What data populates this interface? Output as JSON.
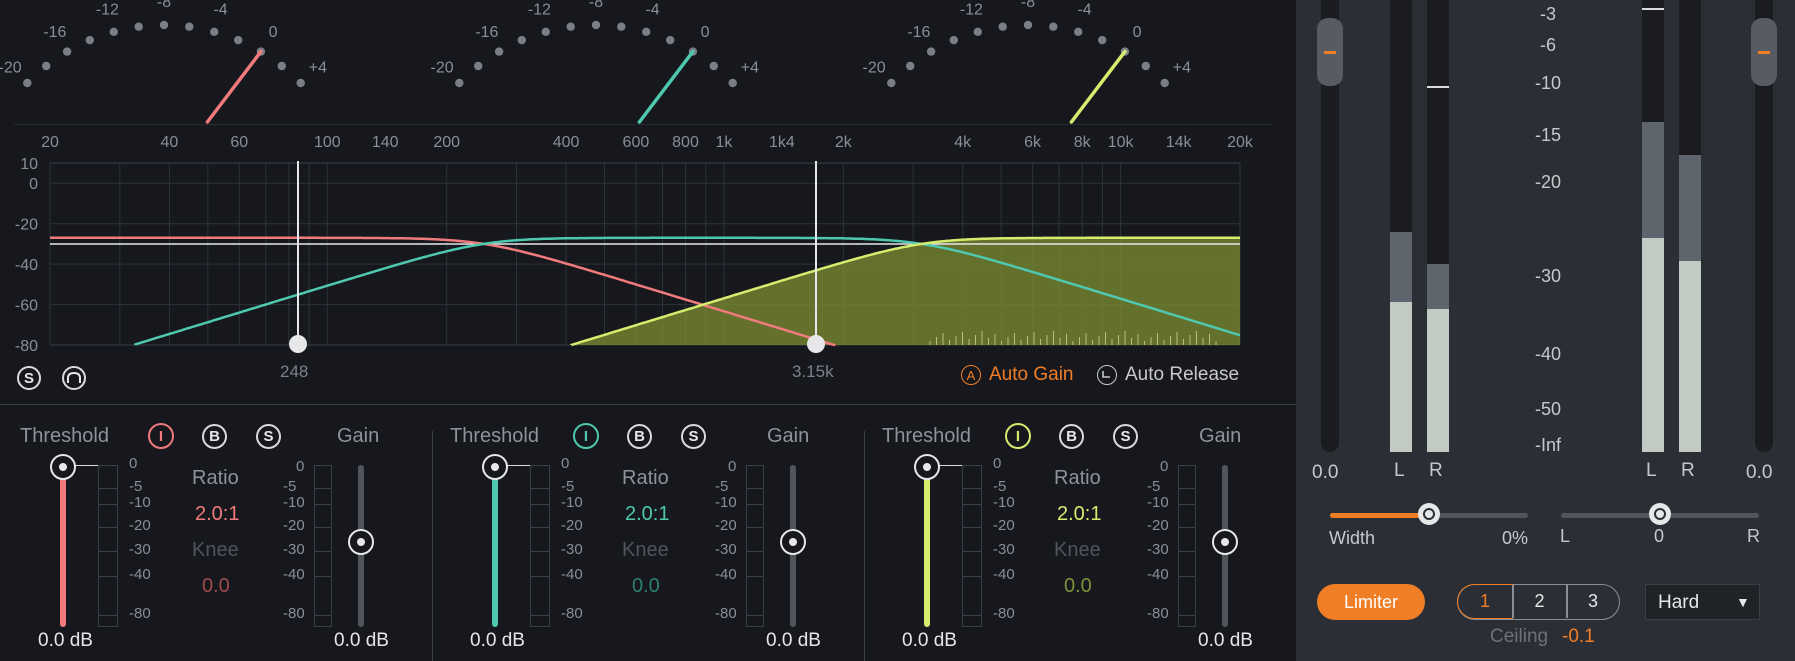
{
  "colors": {
    "band1": "#f07a7c",
    "band2": "#4ec9b0",
    "band3": "#d6ec6e",
    "accent": "#f07e26",
    "bg": "#16181d",
    "panel": "#2b2f35"
  },
  "meters": {
    "scale": [
      "-20",
      "-16",
      "-12",
      "-8",
      "-4",
      "0",
      "+4"
    ]
  },
  "freq_axis": [
    "20",
    "40",
    "60",
    "100",
    "140",
    "200",
    "400",
    "600",
    "800",
    "1k",
    "1k4",
    "2k",
    "4k",
    "6k",
    "8k",
    "10k",
    "14k",
    "20k"
  ],
  "db_axis": [
    "10",
    "0",
    "-20",
    "-40",
    "-60",
    "-80"
  ],
  "crossovers": [
    "248",
    "3.15k"
  ],
  "toolbar": {
    "solo_icon": "S",
    "shape_icon": "filter-shape-icon",
    "auto_gain": "Auto Gain",
    "auto_gain_icon": "A",
    "auto_release": "Auto Release"
  },
  "bands": [
    {
      "threshold_label": "Threshold",
      "bypass_icon": "I",
      "b_label": "B",
      "s_label": "S",
      "gain_label": "Gain",
      "ratio_label": "Ratio",
      "ratio": "2.0:1",
      "knee_label": "Knee",
      "knee": "0.0",
      "threshold_value": "0.0",
      "threshold_unit": "dB",
      "gain_value": "0.0",
      "gain_unit": "dB",
      "thr_scale": [
        "0",
        "-5",
        "-10",
        "-20",
        "-30",
        "-40",
        "-80"
      ],
      "gain_scale": [
        "0",
        "-5",
        "-10",
        "-20",
        "-30",
        "-40",
        "-80"
      ]
    },
    {
      "threshold_label": "Threshold",
      "bypass_icon": "I",
      "b_label": "B",
      "s_label": "S",
      "gain_label": "Gain",
      "ratio_label": "Ratio",
      "ratio": "2.0:1",
      "knee_label": "Knee",
      "knee": "0.0",
      "threshold_value": "0.0",
      "threshold_unit": "dB",
      "gain_value": "0.0",
      "gain_unit": "dB",
      "thr_scale": [
        "0",
        "-5",
        "-10",
        "-20",
        "-30",
        "-40",
        "-80"
      ],
      "gain_scale": [
        "0",
        "-5",
        "-10",
        "-20",
        "-30",
        "-40",
        "-80"
      ]
    },
    {
      "threshold_label": "Threshold",
      "bypass_icon": "I",
      "b_label": "B",
      "s_label": "S",
      "gain_label": "Gain",
      "ratio_label": "Ratio",
      "ratio": "2.0:1",
      "knee_label": "Knee",
      "knee": "0.0",
      "threshold_value": "0.0",
      "threshold_unit": "dB",
      "gain_value": "0.0",
      "gain_unit": "dB",
      "thr_scale": [
        "0",
        "-5",
        "-10",
        "-20",
        "-30",
        "-40",
        "-80"
      ],
      "gain_scale": [
        "0",
        "-5",
        "-10",
        "-20",
        "-30",
        "-40",
        "-80"
      ]
    }
  ],
  "output": {
    "input_value": "0.0",
    "output_value": "0.0",
    "meter_labels": [
      "L",
      "R",
      "L",
      "R"
    ],
    "scale": [
      "-3",
      "-6",
      "-10",
      "-15",
      "-20",
      "-30",
      "-40",
      "-50",
      "-Inf"
    ],
    "width_label": "Width",
    "width_value": "0%",
    "width_amount": 0.5,
    "pan_left": "L",
    "pan_center": "0",
    "pan_right": "R",
    "limiter_label": "Limiter",
    "modes": [
      "1",
      "2",
      "3"
    ],
    "ceiling_label": "Ceiling",
    "ceiling_value": "-0.1",
    "knee_select": "Hard",
    "dropdown_icon": "▼"
  }
}
